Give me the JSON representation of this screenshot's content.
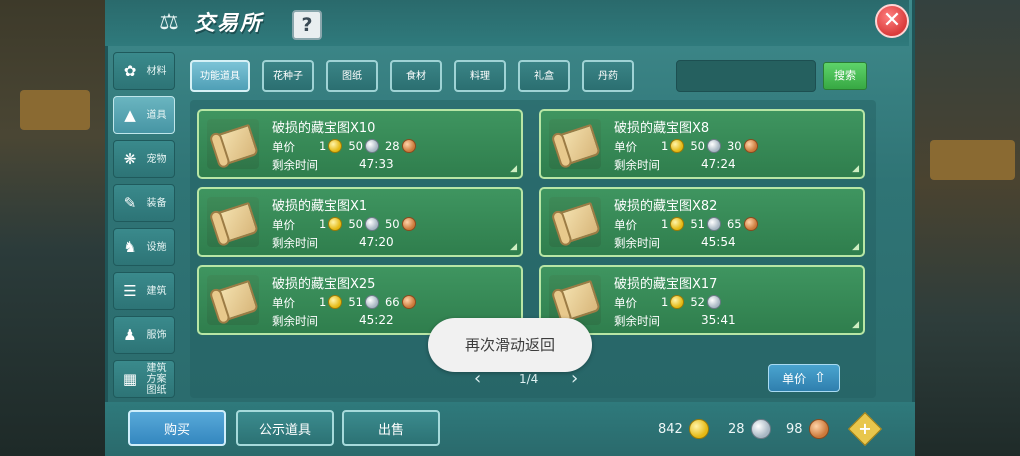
{
  "window": {
    "title": "交易所",
    "help_label": "?",
    "close_label": "✕"
  },
  "sidebar": {
    "items": [
      {
        "label": "材料",
        "icon": "material-icon"
      },
      {
        "label": "道具",
        "icon": "tool-icon",
        "active": true
      },
      {
        "label": "宠物",
        "icon": "pet-icon"
      },
      {
        "label": "装备",
        "icon": "equipment-icon"
      },
      {
        "label": "设施",
        "icon": "facility-icon"
      },
      {
        "label": "建筑",
        "icon": "building-icon"
      },
      {
        "label": "服饰",
        "icon": "clothing-icon"
      },
      {
        "label": "建筑方案图纸",
        "icon": "blueprint-icon"
      }
    ]
  },
  "tabs": [
    {
      "label": "功能道具",
      "active": true
    },
    {
      "label": "花种子"
    },
    {
      "label": "图纸"
    },
    {
      "label": "食材"
    },
    {
      "label": "料理"
    },
    {
      "label": "礼盒"
    },
    {
      "label": "丹药"
    }
  ],
  "search": {
    "value": "",
    "button_label": "搜索"
  },
  "labels": {
    "unit_price": "单价",
    "remaining_time": "剩余时间"
  },
  "items": [
    {
      "name": "破损的藏宝图X10",
      "gold": "1",
      "silver": "50",
      "copper": "28",
      "time": "47:33"
    },
    {
      "name": "破损的藏宝图X8",
      "gold": "1",
      "silver": "50",
      "copper": "30",
      "time": "47:24"
    },
    {
      "name": "破损的藏宝图X1",
      "gold": "1",
      "silver": "50",
      "copper": "50",
      "time": "47:20"
    },
    {
      "name": "破损的藏宝图X82",
      "gold": "1",
      "silver": "51",
      "copper": "65",
      "time": "45:54"
    },
    {
      "name": "破损的藏宝图X25",
      "gold": "1",
      "silver": "51",
      "copper": "66",
      "time": "45:22"
    },
    {
      "name": "破损的藏宝图X17",
      "gold": "1",
      "silver": "52",
      "copper": "",
      "time": "35:41"
    }
  ],
  "pagination": {
    "page_text": "1/4",
    "prev": "‹",
    "next": "›"
  },
  "sort": {
    "label": "单价",
    "direction": "ascending"
  },
  "toast": "再次滑动返回",
  "bottom": {
    "buy_label": "购买",
    "public_label": "公示道具",
    "sell_label": "出售"
  },
  "wallet": {
    "gold": "842",
    "silver": "28",
    "copper": "98"
  },
  "colors": {
    "panel": "#2f7a7c",
    "card": "#3a8d58",
    "search_button": "#46b852",
    "close_button": "#e24a4a"
  }
}
